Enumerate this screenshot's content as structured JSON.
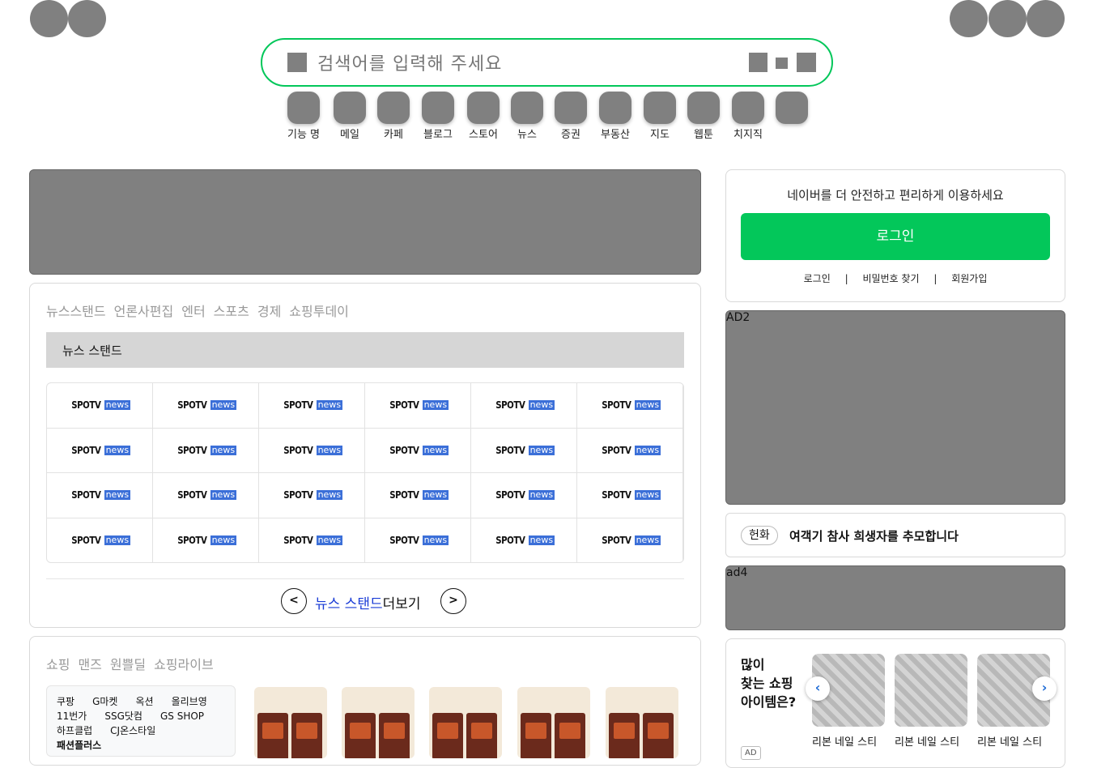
{
  "search": {
    "placeholder": "검색어를 입력해 주세요"
  },
  "shortcuts": [
    "기능 명",
    "메일",
    "카페",
    "블로그",
    "스토어",
    "뉴스",
    "증권",
    "부동산",
    "지도",
    "웹툰",
    "치지직",
    ""
  ],
  "newsstand": {
    "tabs": [
      "뉴스스탠드",
      "언론사편집",
      "엔터",
      "스포츠",
      "경제",
      "쇼핑투데이"
    ],
    "header": "뉴스 스탠드",
    "logo_main": "SPOTV",
    "logo_tag": "news",
    "prev": "<",
    "next": ">",
    "more_highlight": "뉴스 스탠드",
    "more_rest": "더보기"
  },
  "shopping": {
    "tabs": [
      "쇼핑",
      "맨즈",
      "원쁠딜",
      "쇼핑라이브"
    ],
    "links": [
      "쿠팡",
      "G마켓",
      "옥션",
      "올리브영",
      "11번가",
      "SSG닷컴",
      "GS SHOP",
      "하프클럽",
      "CJ온스타일",
      "패션플러스"
    ]
  },
  "login": {
    "message": "네이버를 더 안전하고 편리하게 이용하세요",
    "button": "로그인",
    "links": [
      "로그인",
      "비밀번호 찾기",
      "회원가입"
    ],
    "separator": "|"
  },
  "ads": {
    "ad2": "AD2",
    "ad4": "ad4"
  },
  "notice": {
    "badge": "헌화",
    "text": "여객기 참사 희생자를 추모합니다"
  },
  "popular": {
    "title_lines": [
      "많이",
      "찾는 쇼핑",
      "아이템은?"
    ],
    "items": [
      "리본 네일 스티",
      "리본 네일 스티",
      "리본 네일 스티"
    ],
    "ad_tag": "AD",
    "prev_icon": "chevron-left-icon",
    "next_icon": "chevron-right-icon"
  },
  "colors": {
    "brand": "#03c75a",
    "placeholder_gray": "#808080",
    "link_blue": "#1a3cd6"
  }
}
